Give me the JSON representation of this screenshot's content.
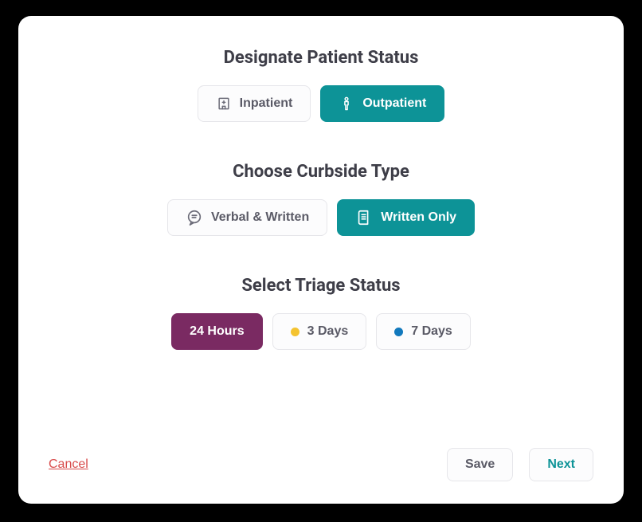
{
  "sections": {
    "patient_status": {
      "title": "Designate Patient Status",
      "options": [
        {
          "label": "Inpatient",
          "selected": false
        },
        {
          "label": "Outpatient",
          "selected": true
        }
      ]
    },
    "curbside_type": {
      "title": "Choose Curbside Type",
      "options": [
        {
          "label": "Verbal & Written",
          "selected": false
        },
        {
          "label": "Written Only",
          "selected": true
        }
      ]
    },
    "triage_status": {
      "title": "Select Triage Status",
      "options": [
        {
          "label": "24 Hours",
          "selected": true
        },
        {
          "label": "3 Days",
          "selected": false,
          "dot": "#f4c330"
        },
        {
          "label": "7 Days",
          "selected": false,
          "dot": "#1279bd"
        }
      ]
    }
  },
  "footer": {
    "cancel": "Cancel",
    "save": "Save",
    "next": "Next"
  },
  "colors": {
    "teal": "#0d9397",
    "purple": "#7a2a62",
    "cancel_red": "#d84b4b"
  }
}
